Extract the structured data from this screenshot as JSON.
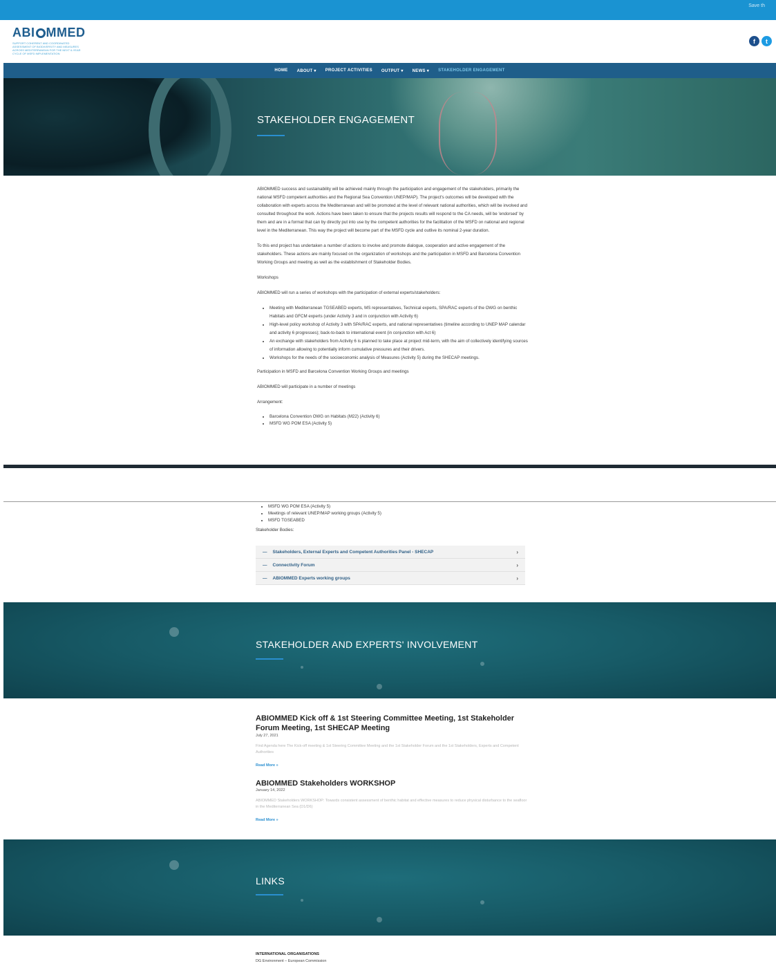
{
  "topbar": {
    "save": "Save th"
  },
  "logo": {
    "name_a": "ABI",
    "name_b": "MMED",
    "tagline": "SUPPORT COHERENT AND COORDINATED ASSESSMENT OF BIODIVERSITY AND MEASURES ACROSS MEDITERRANEAN FOR THE NEXT 6-YEAR CYCLE OF MSFD IMPLEMENTATION"
  },
  "social": {
    "facebook": "f",
    "twitter": "t"
  },
  "nav": [
    "HOME",
    "ABOUT ▾",
    "PROJECT ACTIVITIES",
    "OUTPUT ▾",
    "NEWS ▾",
    "STAKEHOLDER ENGAGEMENT"
  ],
  "hero": {
    "title": "STAKEHOLDER ENGAGEMENT"
  },
  "content": {
    "p1": "ABIOMMED success and sustainability will be achieved mainly through the participation and engagement of the stakeholders, primarily the national MSFD competent authorities and the Regional Sea Convention UNEP/MAP). The project's outcomes will be developed with the collaboration with experts across the Mediterranean and will be promoted at the level of relevant national authorities, which will be involved and consulted throughout the work. Actions have been taken to ensure that the projects results will respond to the CA needs, will be 'endorsed' by them and are in a format that can by directly put into use by the competent authorities for the facilitation of the MSFD on national and regional level in the Mediterranean. This way the project will become part of the MSFD cycle and outlive its nominal 2-year duration.",
    "p2": "To this end project has undertaken a number of actions to involve and promote dialogue, cooperation and active engagement of the stakeholders. These actions are mainly focused on the organization of workshops and the participation in MSFD and Barcelona Convention Working Groups and meeting as well as the establishment of Stakeholder Bodies.",
    "workshops_heading": "Workshops",
    "workshops_intro": "ABIOMMED will run a series of workshops with the participation of external experts/stakeholders:",
    "workshops": [
      "Meeting with Mediterranean TGSEABED experts, MS representatives, Technical experts, SPA/RAC experts of the OWG on benthic Habitats and GFCM experts (under Activity 3 and in conjunction with Activity 6)",
      "High-level policy workshop of Activity 3 with SPA/RAC experts, and national representatives (timeline according to UNEP MAP calendar and activity 6 progresses); back-to-back to international event (in conjunction with Act 6)",
      "An exchange with stakeholders from Activity 6 is planned to take place at project mid-term, with the aim of collectively identifying sources of information allowing to potentially inform cumulative pressures and their drivers.",
      "Workshops for the needs of the socioeconomic analysis of Measures (Activity 5) during the SHECAP meetings."
    ],
    "participation_heading": "Participation in MSFD and Barcelona Convention Working Groups and meetings",
    "participation_intro": "ABIOMMED will participate in a number of meetings",
    "arrangement_heading": "Arrangement:",
    "meetings_top": [
      "Barcelona Convention OWG on Habitats (M22) (Activity 6)",
      "MSFD WG POM ESA (Activity 5)"
    ],
    "meetings_bottom": [
      "MSFD WG POM ESA (Activity 5)",
      "Meetings of relevant UNEP/MAP working groups (Activity 5)",
      "MSFD TGSEABED"
    ],
    "bodies_heading": "Stakeholder Bodies:"
  },
  "accordion": [
    "Stakeholders, External Experts and Competent Authorities Panel - SHECAP",
    "Connectivity Forum",
    "ABIOMMED Experts working groups"
  ],
  "involvement": {
    "title": "STAKEHOLDER AND EXPERTS' INVOLVEMENT"
  },
  "posts": [
    {
      "title": "ABIOMMED Kick off & 1st Steering Committee Meeting, 1st Stakeholder Forum Meeting, 1st SHECAP Meeting",
      "date": "July 27, 2021",
      "excerpt": "Find Agenda here The Kick-off meeting & 1st Steering Committee Meeting and the 1st Stakeholder Forum and the 1st Stakeholders, Experts and Competent Authorities",
      "readmore": "Read More »"
    },
    {
      "title": "ABIOMMED Stakeholders WORKSHOP",
      "date": "January 14, 2022",
      "excerpt": "ABIOMMED Stakeholders WORKSHOP: Towards consistent assessment of benthic habitat and effective measures to reduce physical disturbance to the seafloor in the Mediterranean Sea (D1/D6)",
      "readmore": "Read More »"
    }
  ],
  "links": {
    "title": "LINKS",
    "heading": "INTERNATIONAL ORGANISATIONS",
    "item": "DG Environment – European Commission"
  }
}
